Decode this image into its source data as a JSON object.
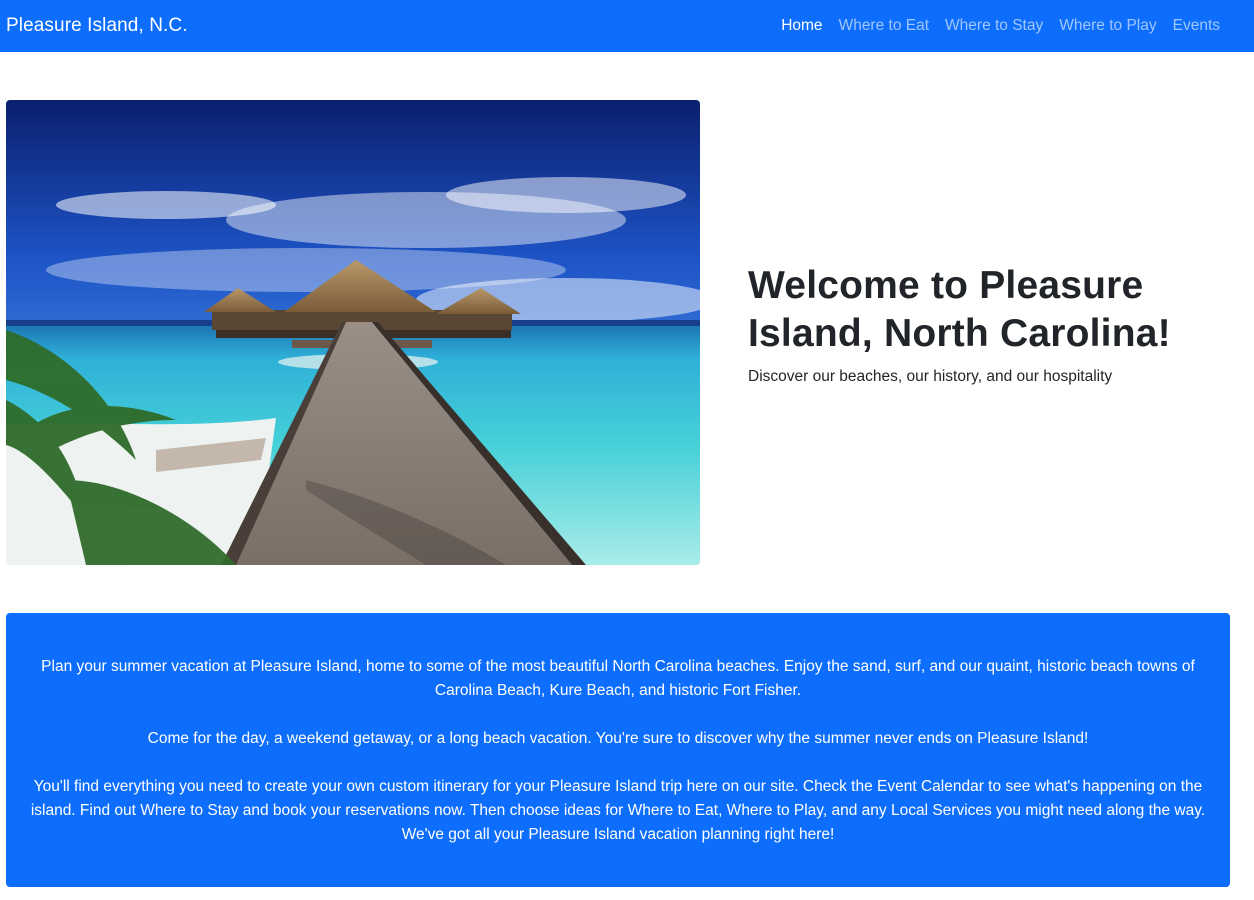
{
  "navbar": {
    "brand": "Pleasure Island, N.C.",
    "links": [
      {
        "label": "Home",
        "active": true
      },
      {
        "label": "Where to Eat",
        "active": false
      },
      {
        "label": "Where to Stay",
        "active": false
      },
      {
        "label": "Where to Play",
        "active": false
      },
      {
        "label": "Events",
        "active": false
      }
    ]
  },
  "hero": {
    "title": "Welcome to Pleasure Island, North Carolina!",
    "subtitle": "Discover our beaches, our history, and our hospitality"
  },
  "info": {
    "paragraphs": [
      "Plan your summer vacation at Pleasure Island, home to some of the most beautiful North Carolina beaches. Enjoy the sand, surf, and our quaint, historic beach towns of Carolina Beach, Kure Beach, and historic Fort Fisher.",
      "Come for the day, a weekend getaway, or a long beach vacation. You're sure to discover why the summer never ends on Pleasure Island!",
      "You'll find everything you need to create your own custom itinerary for your Pleasure Island trip here on our site. Check the Event Calendar to see what's happening on the island. Find out Where to Stay and book your reservations now. Then choose ideas for Where to Eat, Where to Play, and any Local Services you might need along the way. We've got all your Pleasure Island vacation planning right here!"
    ]
  },
  "colors": {
    "primary": "#0d6efd",
    "nav_active": "#ffffff",
    "nav_inactive": "rgba(255,255,255,0.6)"
  }
}
